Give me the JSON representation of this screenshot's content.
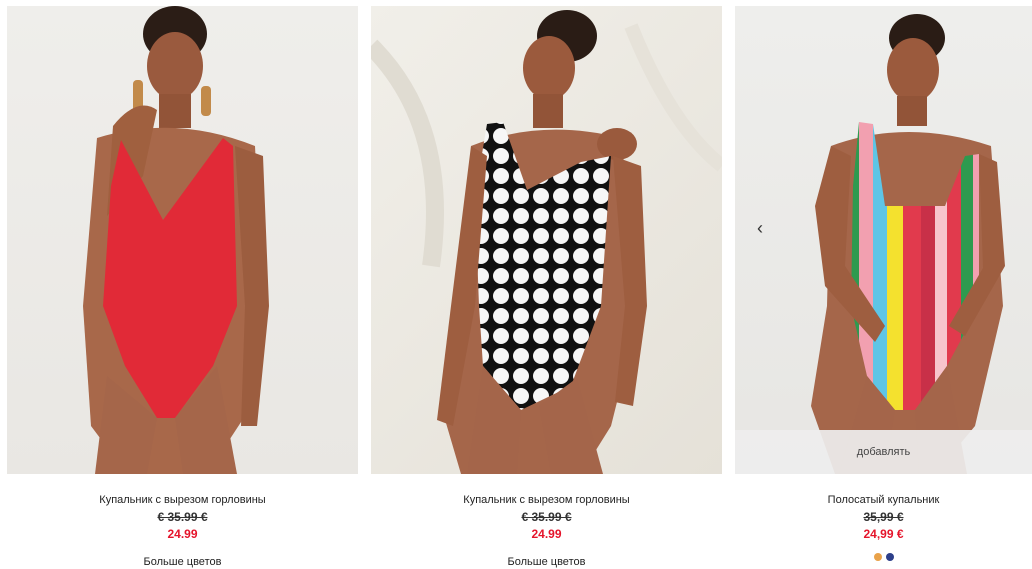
{
  "products": [
    {
      "title": "Купальник с вырезом горловины",
      "old_price": "€ 35.99 €",
      "new_price": "24.99",
      "more_colors": "Больше цветов"
    },
    {
      "title": "Купальник с вырезом горловины",
      "old_price": "€ 35.99 €",
      "new_price": "24.99",
      "more_colors": "Больше цветов"
    },
    {
      "title": "Полосатый купальник",
      "old_price": "35,99 €",
      "new_price": "24,99 €",
      "add_label": "добавлять",
      "prev_icon": "chevron-left-icon"
    }
  ],
  "colors": {
    "sale_red": "#e5142b",
    "swim_red": "#e12a37",
    "skin": "#a8684a"
  }
}
